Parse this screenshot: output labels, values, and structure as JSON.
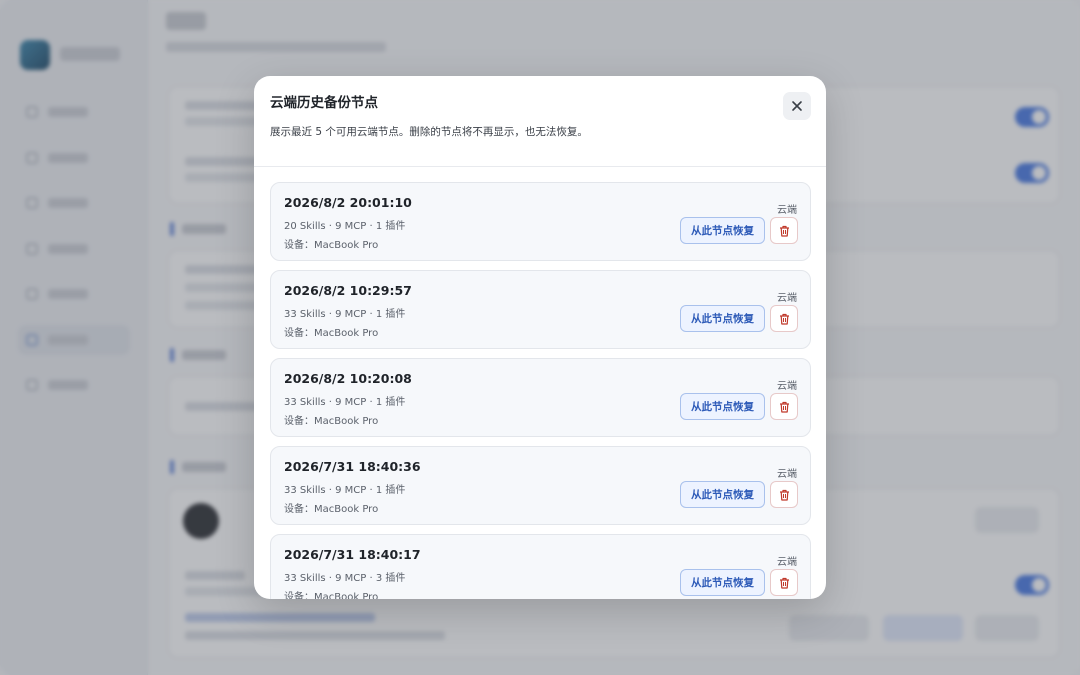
{
  "modal": {
    "title": "云端历史备份节点",
    "description": "展示最近 5 个可用云端节点。删除的节点将不再显示，也无法恢复。",
    "close_icon": "close-icon",
    "restore_label": "从此节点恢复",
    "delete_icon": "trash-icon",
    "accent_color": "#2e5bb8",
    "danger_color": "#c0392b"
  },
  "nodes": [
    {
      "datetime": "2026/8/2 20:01:10",
      "stats": "20 Skills · 9 MCP · 1 插件",
      "device": "设备：MacBook Pro",
      "tag": "云端"
    },
    {
      "datetime": "2026/8/2 10:29:57",
      "stats": "33 Skills · 9 MCP · 1 插件",
      "device": "设备：MacBook Pro",
      "tag": "云端"
    },
    {
      "datetime": "2026/8/2 10:20:08",
      "stats": "33 Skills · 9 MCP · 1 插件",
      "device": "设备：MacBook Pro",
      "tag": "云端"
    },
    {
      "datetime": "2026/7/31 18:40:36",
      "stats": "33 Skills · 9 MCP · 1 插件",
      "device": "设备：MacBook Pro",
      "tag": "云端"
    },
    {
      "datetime": "2026/7/31 18:40:17",
      "stats": "33 Skills · 9 MCP · 3 插件",
      "device": "设备：MacBook Pro",
      "tag": "云端"
    }
  ]
}
